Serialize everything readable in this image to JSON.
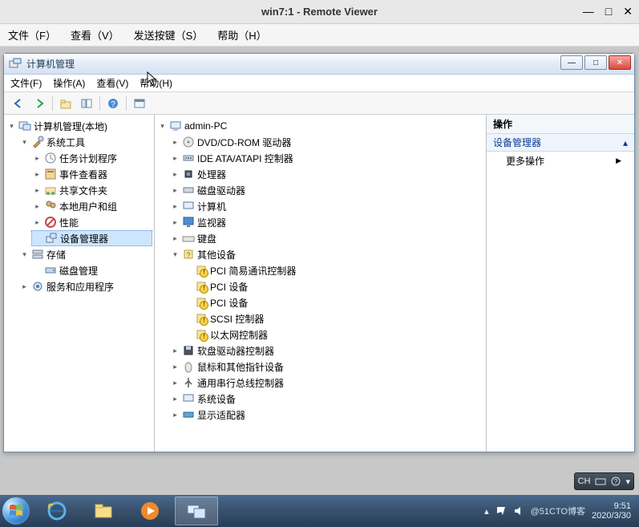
{
  "viewer": {
    "title": "win7:1 - Remote Viewer",
    "menus": {
      "file": "文件（F）",
      "view": "查看（V）",
      "sendkey": "发送按键（S）",
      "help": "帮助（H）"
    },
    "controls": {
      "min": "—",
      "max": "□",
      "close": "✕"
    }
  },
  "mmc": {
    "title": "计算机管理",
    "menus": {
      "file": "文件(F)",
      "action": "操作(A)",
      "view": "查看(V)",
      "help": "帮助(H)"
    }
  },
  "leftTree": {
    "root": "计算机管理(本地)",
    "sysTools": "系统工具",
    "taskSched": "任务计划程序",
    "eventViewer": "事件查看器",
    "sharedFolders": "共享文件夹",
    "localUsers": "本地用户和组",
    "performance": "性能",
    "deviceMgr": "设备管理器",
    "storage": "存储",
    "diskMgmt": "磁盘管理",
    "services": "服务和应用程序"
  },
  "midTree": {
    "root": "admin-PC",
    "dvd": "DVD/CD-ROM 驱动器",
    "ide": "IDE ATA/ATAPI 控制器",
    "cpu": "处理器",
    "diskDrives": "磁盘驱动器",
    "computer": "计算机",
    "monitor": "监视器",
    "keyboard": "键盘",
    "otherDevices": "其他设备",
    "pciComm": "PCI 简易通讯控制器",
    "pciDev1": "PCI 设备",
    "pciDev2": "PCI 设备",
    "scsi": "SCSI 控制器",
    "ethernet": "以太网控制器",
    "floppy": "软盘驱动器控制器",
    "mouse": "鼠标和其他指针设备",
    "usb": "通用串行总线控制器",
    "sysDevices": "系统设备",
    "display": "显示适配器"
  },
  "actions": {
    "header": "操作",
    "panel": "设备管理器",
    "more": "更多操作"
  },
  "ime": {
    "ch": "CH"
  },
  "tray": {
    "time": "9:51",
    "date": "2020/3/30",
    "watermark": "@51CTO博客"
  }
}
